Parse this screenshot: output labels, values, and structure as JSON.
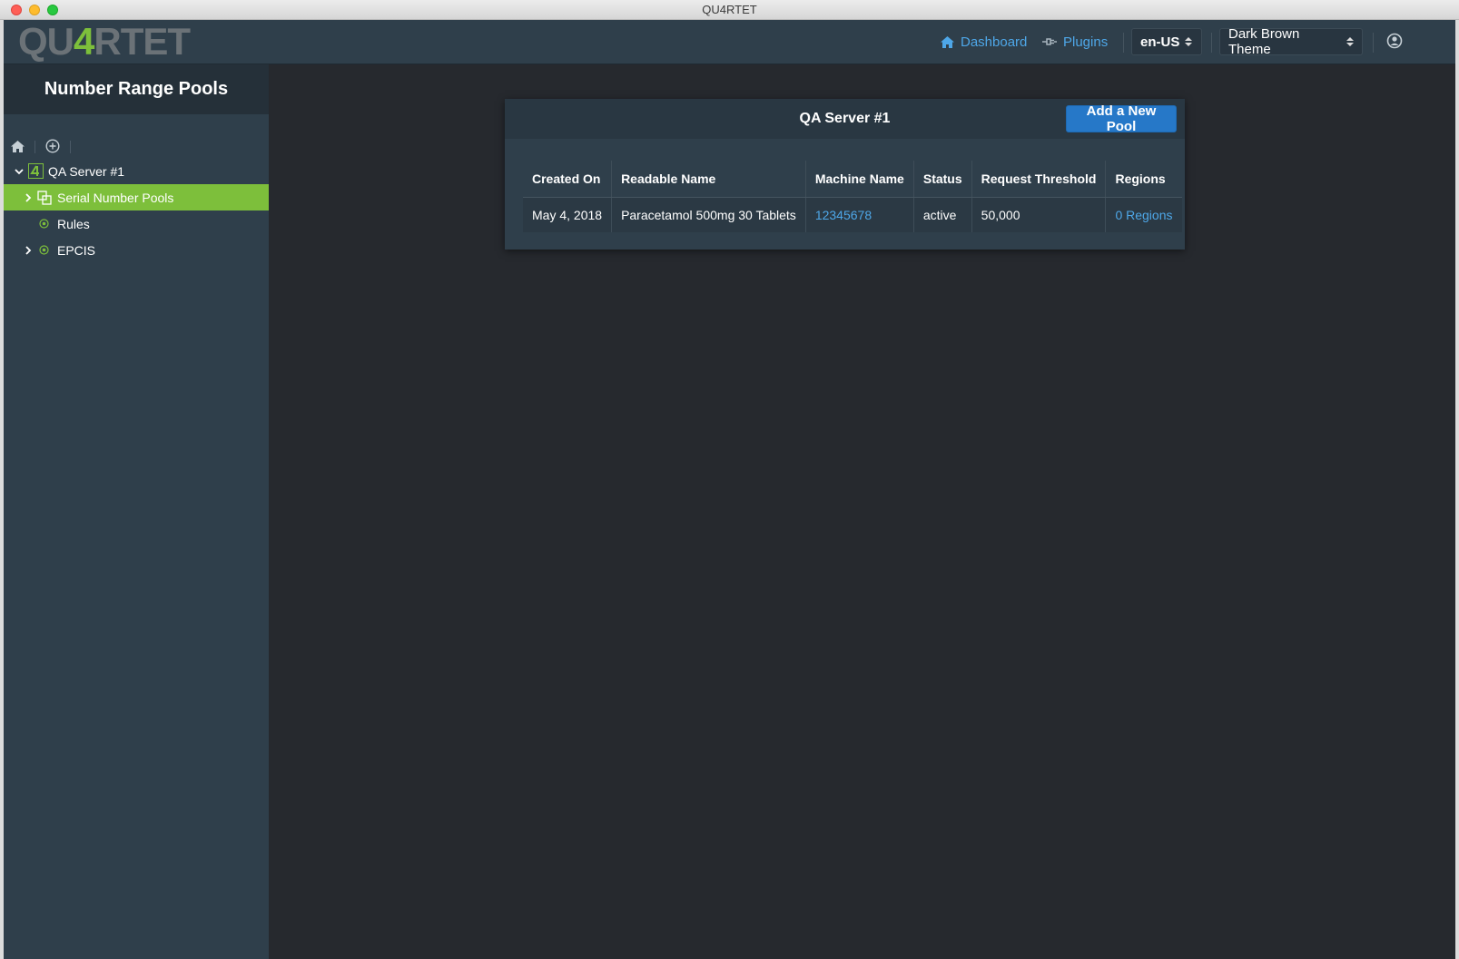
{
  "window": {
    "title": "QU4RTET"
  },
  "navbar": {
    "logo_prefix": "QU",
    "logo_four": "4",
    "logo_suffix": "RTET",
    "dashboard_label": "Dashboard",
    "plugins_label": "Plugins",
    "language": "en-US",
    "theme": "Dark Brown Theme",
    "link_color": "#4ea7e8"
  },
  "sidebar": {
    "title": "Number Range Pools",
    "tools": [
      "home-icon",
      "plus-circle-icon"
    ],
    "tree": [
      {
        "label": "QA Server #1",
        "icon": "quartet-logo-icon",
        "expanded": true
      },
      {
        "label": "Serial Number Pools",
        "icon": "pools-icon",
        "selected": true
      },
      {
        "label": "Rules",
        "icon": "target-icon"
      },
      {
        "label": "EPCIS",
        "icon": "target-icon",
        "expanded": false
      }
    ],
    "selected_color": "#7dbf3b"
  },
  "panel": {
    "title": "QA Server #1",
    "add_button": "Add a New Pool",
    "columns": [
      "Created On",
      "Readable Name",
      "Machine Name",
      "Status",
      "Request Threshold",
      "Regions"
    ],
    "rows": [
      {
        "created_on": "May 4, 2018",
        "readable_name": "Paracetamol 500mg 30 Tablets",
        "machine_name": "12345678",
        "status": "active",
        "request_threshold": "50,000",
        "regions": "0 Regions"
      }
    ]
  }
}
